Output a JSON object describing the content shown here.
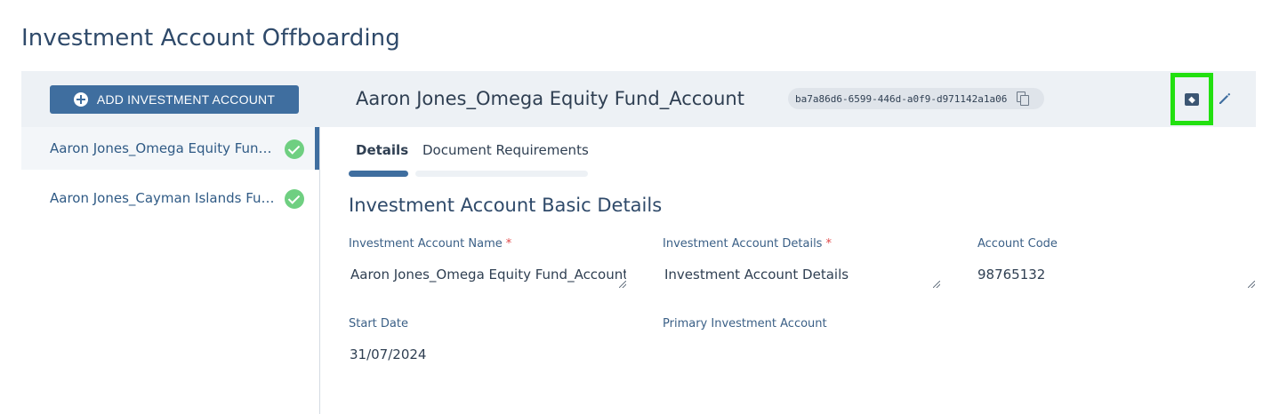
{
  "page": {
    "title": "Investment Account Offboarding"
  },
  "toolbar": {
    "add_label": "ADD INVESTMENT ACCOUNT",
    "account_title": "Aaron Jones_Omega Equity Fund_Account",
    "account_id": "ba7a86d6-6599-446d-a0f9-d971142a1a06"
  },
  "sidebar": {
    "items": [
      {
        "label": "Aaron Jones_Omega Equity Fund_Account",
        "status": "complete"
      },
      {
        "label": "Aaron Jones_Cayman Islands Fund_Account",
        "status": "complete"
      }
    ]
  },
  "tabs": [
    {
      "label": "Details"
    },
    {
      "label": "Document Requirements"
    }
  ],
  "section": {
    "title": "Investment Account Basic Details"
  },
  "fields": {
    "name_label": "Investment Account Name",
    "name_value": "Aaron Jones_Omega Equity Fund_Account",
    "details_label": "Investment Account Details",
    "details_value": "Investment Account Details",
    "code_label": "Account Code",
    "code_value": "98765132",
    "start_label": "Start Date",
    "start_value": "31/07/2024",
    "primary_label": "Primary Investment Account",
    "required_mark": "*"
  },
  "colors": {
    "accent": "#3f6e9f",
    "success": "#6fcf81",
    "highlight": "#22e010"
  },
  "icons": [
    "plus-circle-icon",
    "copy-icon",
    "archive-icon",
    "edit-pencil-icon",
    "check-circle-icon"
  ]
}
